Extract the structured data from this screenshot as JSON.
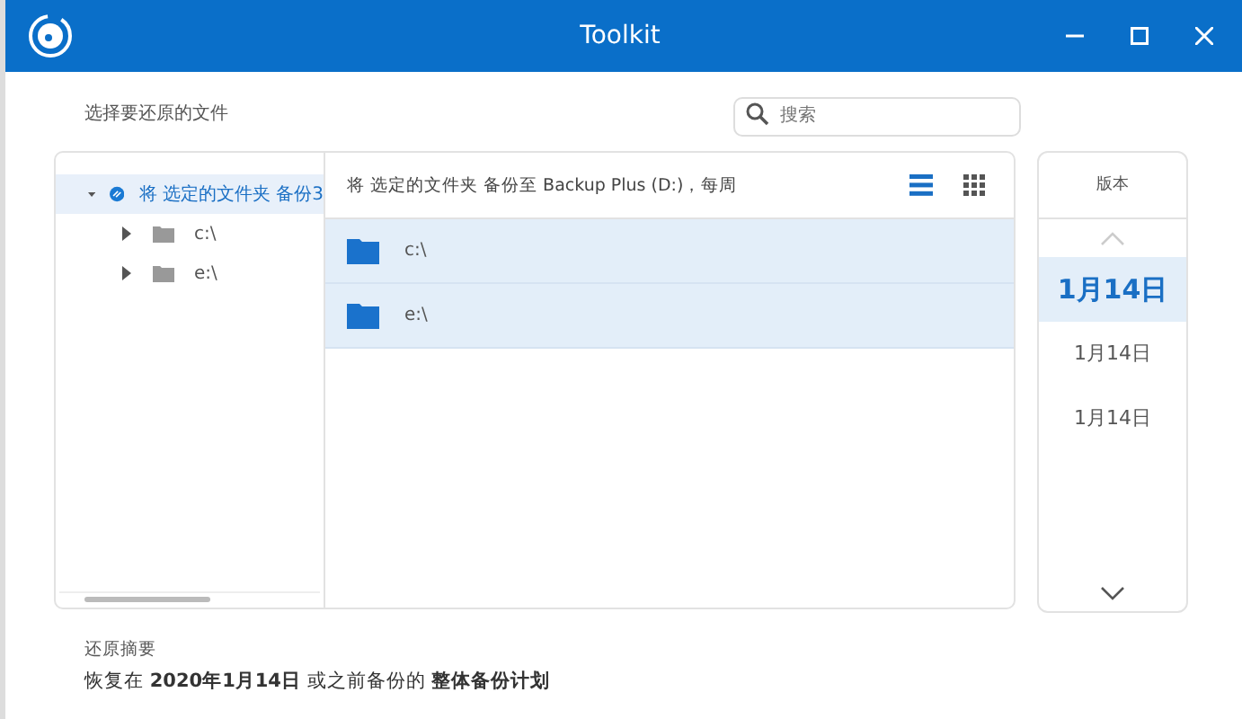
{
  "window": {
    "title": "Toolkit"
  },
  "section_label": "选择要还原的文件",
  "search": {
    "placeholder": "搜索"
  },
  "tree": {
    "label": "将 选定的文件夹 备份3",
    "expanded": true,
    "selected": true,
    "children": [
      {
        "label": "c:\\",
        "expanded": false
      },
      {
        "label": "e:\\",
        "expanded": false
      }
    ]
  },
  "list": {
    "header": "将 选定的文件夹 备份至 Backup Plus (D:)，每周",
    "view_buttons": [
      {
        "kind": "list",
        "selected": true
      },
      {
        "kind": "grid",
        "selected": false
      }
    ],
    "rows": [
      {
        "name": "c:\\",
        "selected": true
      },
      {
        "name": "e:\\",
        "selected": true
      }
    ]
  },
  "versions": {
    "title": "版本",
    "items": [
      {
        "label": "1月14日",
        "selected": true
      },
      {
        "label": "1月14日",
        "selected": false
      },
      {
        "label": "1月14日",
        "selected": false
      }
    ]
  },
  "summary": {
    "title": "还原摘要",
    "text": "恢复在 **2020年1月14日** 或之前备份的 **整体备份计划**"
  }
}
